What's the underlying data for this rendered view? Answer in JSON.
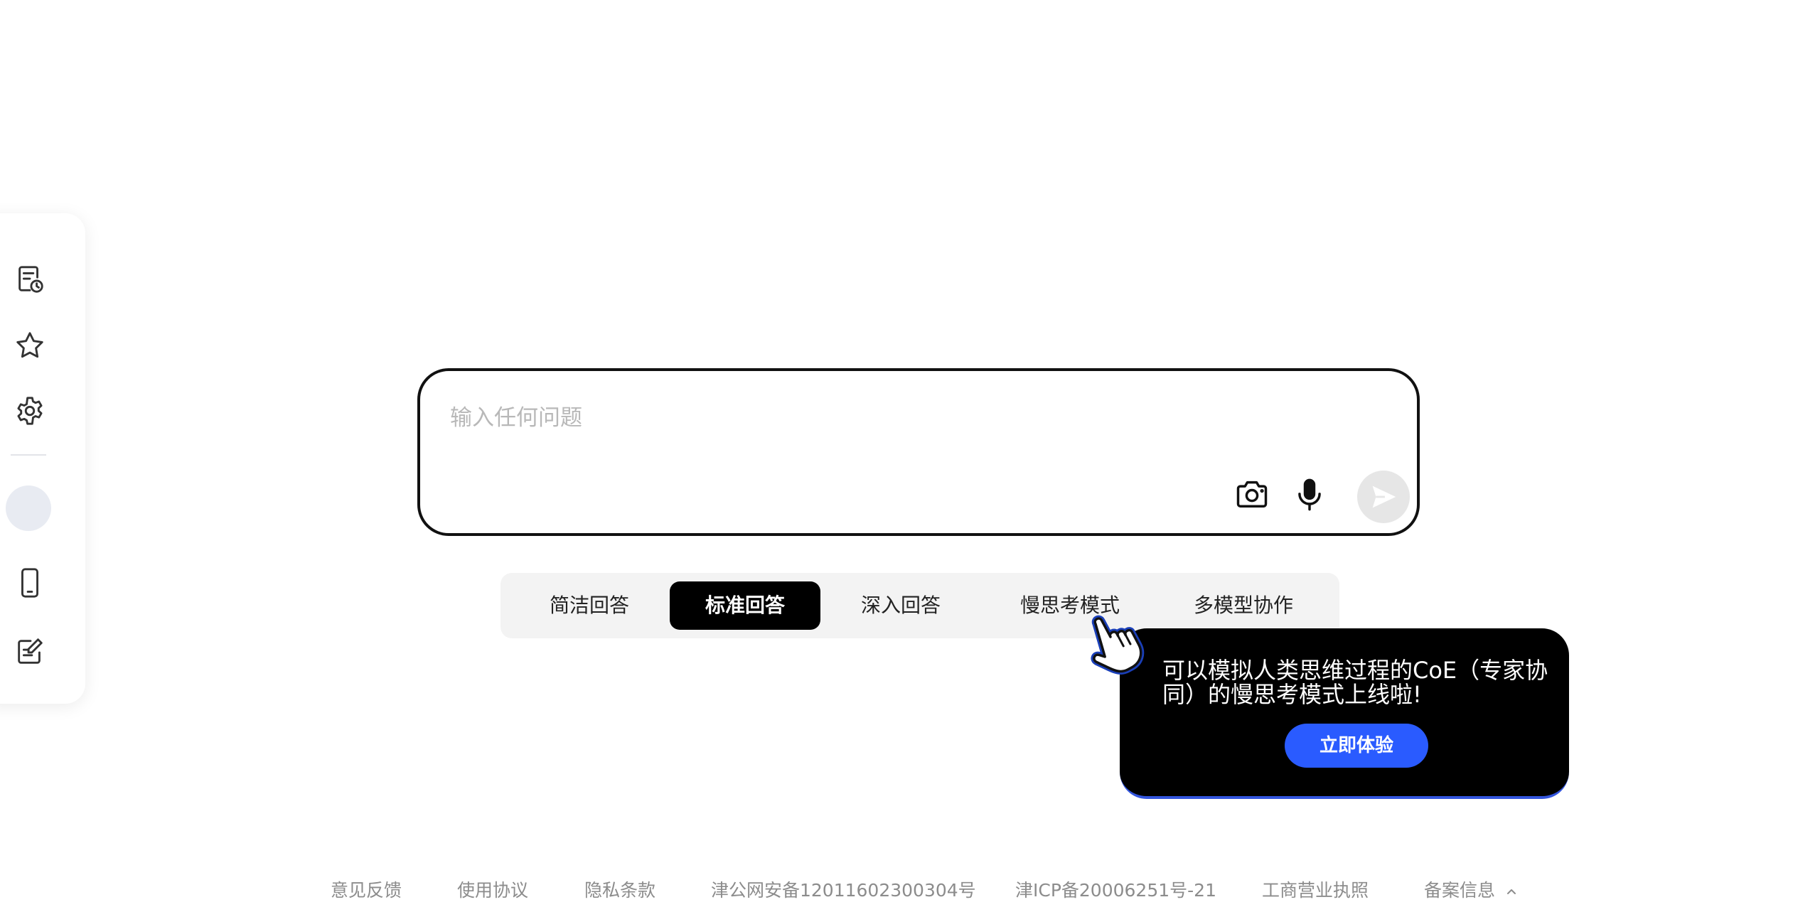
{
  "sidebar": {
    "items": [
      {
        "icon": "history-document-icon",
        "tooltip": ""
      },
      {
        "icon": "star-icon",
        "tooltip": ""
      },
      {
        "icon": "gear-icon",
        "tooltip": ""
      },
      {
        "icon": "avatar",
        "tooltip": ""
      },
      {
        "icon": "mobile-phone-icon",
        "tooltip": ""
      },
      {
        "icon": "edit-note-icon",
        "tooltip": ""
      }
    ]
  },
  "search": {
    "placeholder": "输入任何问题",
    "value": "",
    "camera_icon": "camera-icon",
    "mic_icon": "microphone-icon",
    "send_icon": "send-icon"
  },
  "modes": {
    "active": "标准回答",
    "tabs": [
      {
        "label": "简洁回答"
      },
      {
        "label": "标准回答"
      },
      {
        "label": "深入回答"
      },
      {
        "label": "慢思考模式"
      },
      {
        "label": "多模型协作"
      }
    ]
  },
  "promo": {
    "message": "可以模拟人类思维过程的CoE（专家协同）的慢思考模式上线啦!",
    "cta_label": "立即体验",
    "colors": {
      "background": "#000000",
      "button": "#2a5bff"
    }
  },
  "footer": {
    "links": [
      {
        "label": "意见反馈"
      },
      {
        "label": "使用协议"
      },
      {
        "label": "隐私条款"
      },
      {
        "label": "津公网安备12011602300304号"
      },
      {
        "label": "津ICP备20006251号-21"
      },
      {
        "label": "工商营业执照"
      },
      {
        "label": "备案信息"
      }
    ]
  }
}
